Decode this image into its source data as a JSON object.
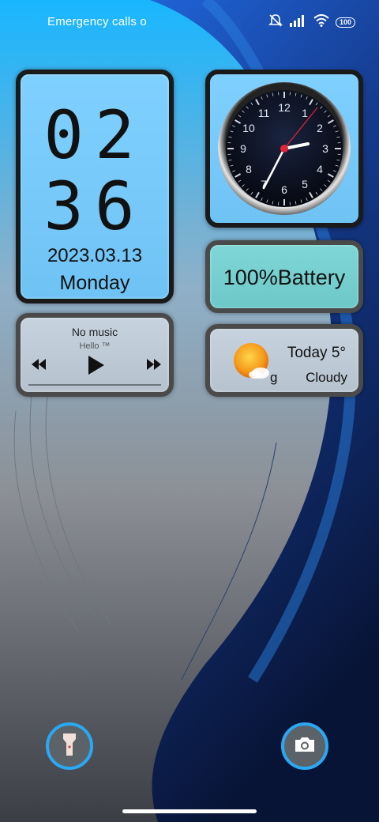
{
  "status_bar": {
    "carrier_text": "Emergency calls o",
    "battery_level": "100",
    "icons": [
      "mute-icon",
      "signal-icon",
      "wifi-icon",
      "battery-icon"
    ]
  },
  "clock_widget": {
    "hours": "02",
    "minutes": "36",
    "date": "2023.03.13",
    "day": "Monday"
  },
  "analog_clock": {
    "numbers": [
      "12",
      "1",
      "2",
      "3",
      "4",
      "5",
      "6",
      "7",
      "8",
      "9",
      "10",
      "11"
    ]
  },
  "battery_widget": {
    "text": "100%Battery"
  },
  "music_widget": {
    "title": "No music",
    "artist": "Hello ™"
  },
  "weather_widget": {
    "today": "Today 5°",
    "partial": "g",
    "condition": "Cloudy"
  },
  "bottom": {
    "left_icon": "flashlight-icon",
    "right_icon": "camera-icon"
  },
  "colors": {
    "accent_ring": "#2aa9f2",
    "top_gradient": "#1fb6ff",
    "dark_blue": "#0b1f5a"
  }
}
